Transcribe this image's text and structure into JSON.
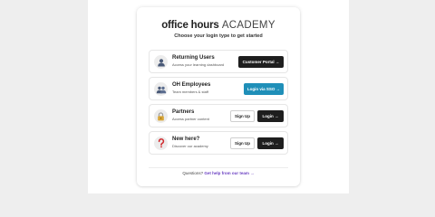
{
  "brand": {
    "name_bold": "office hours",
    "name_light": "ACADEMY"
  },
  "subtitle": "Choose your login type to get started",
  "options": [
    {
      "id": "returning",
      "icon": "user-icon",
      "title": "Returning Users",
      "description": "Access your learning dashboard",
      "buttons": [
        {
          "label": "Customer Portal →",
          "style": "dark"
        }
      ]
    },
    {
      "id": "employees",
      "icon": "users-group-icon",
      "title": "OH Employees",
      "description": "Team members & staff",
      "buttons": [
        {
          "label": "Login via SSO →",
          "style": "teal"
        }
      ]
    },
    {
      "id": "partners",
      "icon": "lock-icon",
      "title": "Partners",
      "description": "Access partner content",
      "buttons": [
        {
          "label": "Sign Up",
          "style": "outline"
        },
        {
          "label": "Login →",
          "style": "dark"
        }
      ]
    },
    {
      "id": "new",
      "icon": "question-icon",
      "title": "New here?",
      "description": "Discover our academy",
      "buttons": [
        {
          "label": "Sign Up",
          "style": "outline"
        },
        {
          "label": "Login →",
          "style": "dark"
        }
      ]
    }
  ],
  "footer": {
    "prefix": "Questions?",
    "link": "Get help from our team →"
  },
  "colors": {
    "dark": "#1e1e1e",
    "teal": "#1f8fb8",
    "link": "#6a3fc2",
    "background": "#eeeeee"
  }
}
